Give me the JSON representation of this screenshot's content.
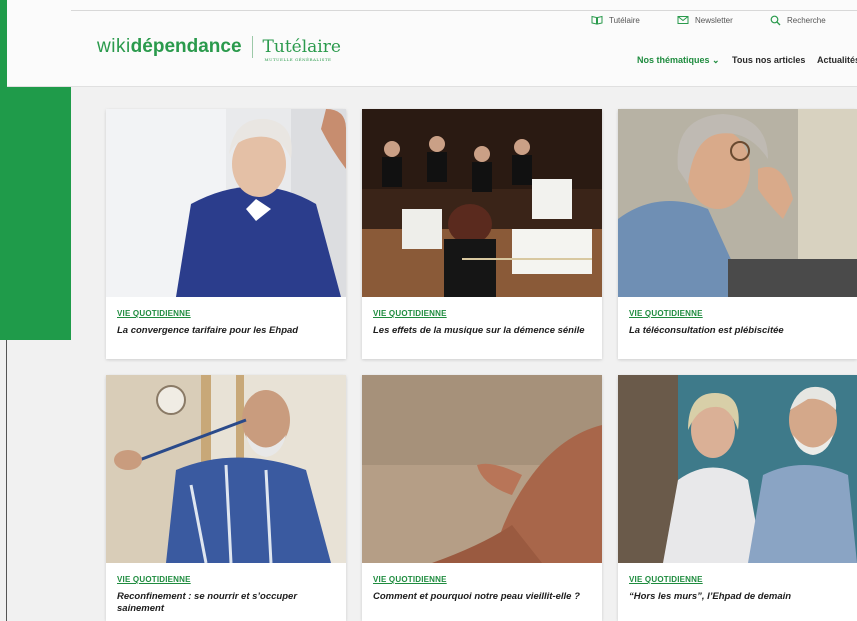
{
  "header": {
    "logo_wiki": "wiki",
    "logo_dependance": "dépendance",
    "logo_tutelaire": "Tutélaire",
    "logo_tutelaire_sub": "MUTUELLE GÉNÉRALISTE",
    "top_links": [
      {
        "label": "Tutélaire",
        "icon": "book-icon"
      },
      {
        "label": "Newsletter",
        "icon": "mail-icon"
      },
      {
        "label": "Recherche",
        "icon": "search-icon"
      }
    ],
    "nav": [
      {
        "label": "Nos thématiques ⌄"
      },
      {
        "label": "Tous nos articles"
      },
      {
        "label": "Actualités"
      }
    ]
  },
  "cards": [
    {
      "category": "VIE QUOTIDIENNE",
      "title": "La convergence tarifaire pour les Ehpad",
      "image": "elderly-woman-smiling-photo"
    },
    {
      "category": "VIE QUOTIDIENNE",
      "title": "Les effets de la musique sur la démence sénile",
      "image": "orchestra-musicians-photo"
    },
    {
      "category": "VIE QUOTIDIENNE",
      "title": "La téléconsultation est plébiscitée",
      "image": "woman-laughing-glasses-photo"
    },
    {
      "category": "VIE QUOTIDIENNE",
      "title": "Reconfinement : se nourrir et s’occuper sainement",
      "image": "elderly-man-painting-photo"
    },
    {
      "category": "VIE QUOTIDIENNE",
      "title": "Comment et pourquoi notre peau vieillit-elle ?",
      "image": "aged-hands-photo"
    },
    {
      "category": "VIE QUOTIDIENNE",
      "title": "“Hors les murs”, l’Ehpad de demain",
      "image": "elderly-couple-photo"
    }
  ],
  "colors": {
    "brand_green": "#1f9b4a",
    "text_dark": "#1c1c1c"
  }
}
